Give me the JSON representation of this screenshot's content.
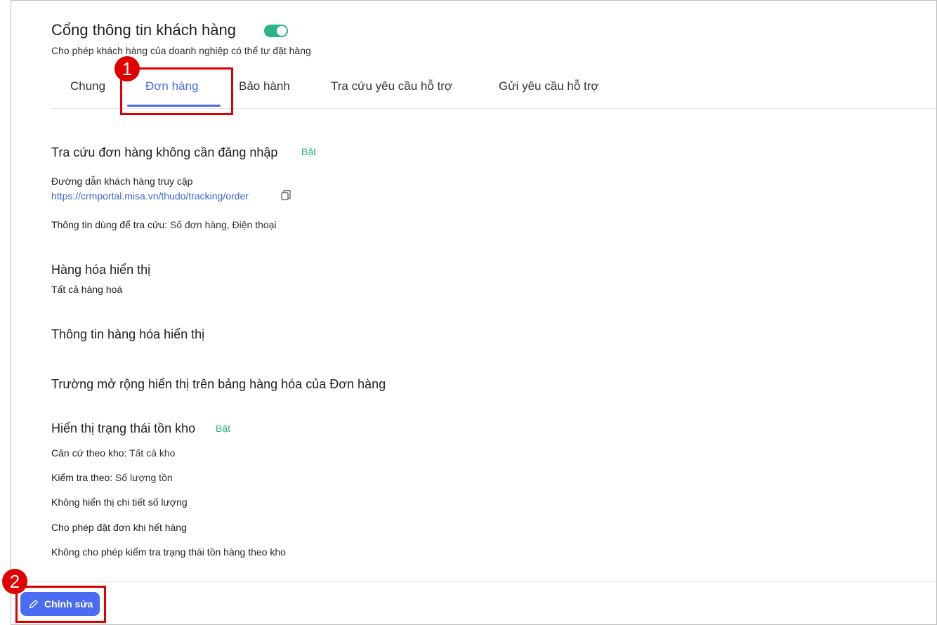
{
  "header": {
    "title": "Cổng thông tin khách hàng",
    "toggle_on": true,
    "subtitle": "Cho phép khách hàng của doanh nghiệp có thể tự đặt hàng"
  },
  "tabs": [
    {
      "label": "Chung",
      "active": false
    },
    {
      "label": "Đơn hàng",
      "active": true
    },
    {
      "label": "Bảo hành",
      "active": false
    },
    {
      "label": "Tra cứu yêu cầu hỗ trợ",
      "active": false
    },
    {
      "label": "Gửi yêu cầu hỗ trợ",
      "active": false
    }
  ],
  "callouts": {
    "one": "1",
    "two": "2"
  },
  "lookup": {
    "title": "Tra cứu đơn hàng không cần đăng nhập",
    "status": "Bật",
    "url_label": "Đường dẫn khách hàng truy cập",
    "url": "https://crmportal.misa.vn/thudo/tracking/order",
    "info_label": "Thông tin dùng để tra cứu:",
    "info_value": "Số đơn hàng, Điện thoại"
  },
  "goods": {
    "title": "Hàng hóa hiển thị",
    "value": "Tất cả hàng hoá"
  },
  "goods_info": {
    "title": "Thông tin hàng hóa hiển thị"
  },
  "extended_fields": {
    "title": "Trường mở rộng hiển thị trên bảng hàng hóa của Đơn hàng"
  },
  "stock": {
    "title": "Hiển thị trạng thái tồn kho",
    "status": "Bật",
    "warehouse_label": "Căn cứ theo kho:",
    "warehouse_value": "Tất cả kho",
    "check_label": "Kiểm tra theo:",
    "check_value": "Số lượng tồn",
    "option1": "Không hiển thị chi tiết số lượng",
    "option2": "Cho phép đặt đơn khi hết hàng",
    "option3": "Không cho phép kiểm tra trạng thái tồn hàng theo kho"
  },
  "footer": {
    "edit_label": "Chỉnh sửa"
  },
  "colors": {
    "accent": "#4a6cf0",
    "success": "#2bb38a",
    "callout": "#e00000"
  }
}
